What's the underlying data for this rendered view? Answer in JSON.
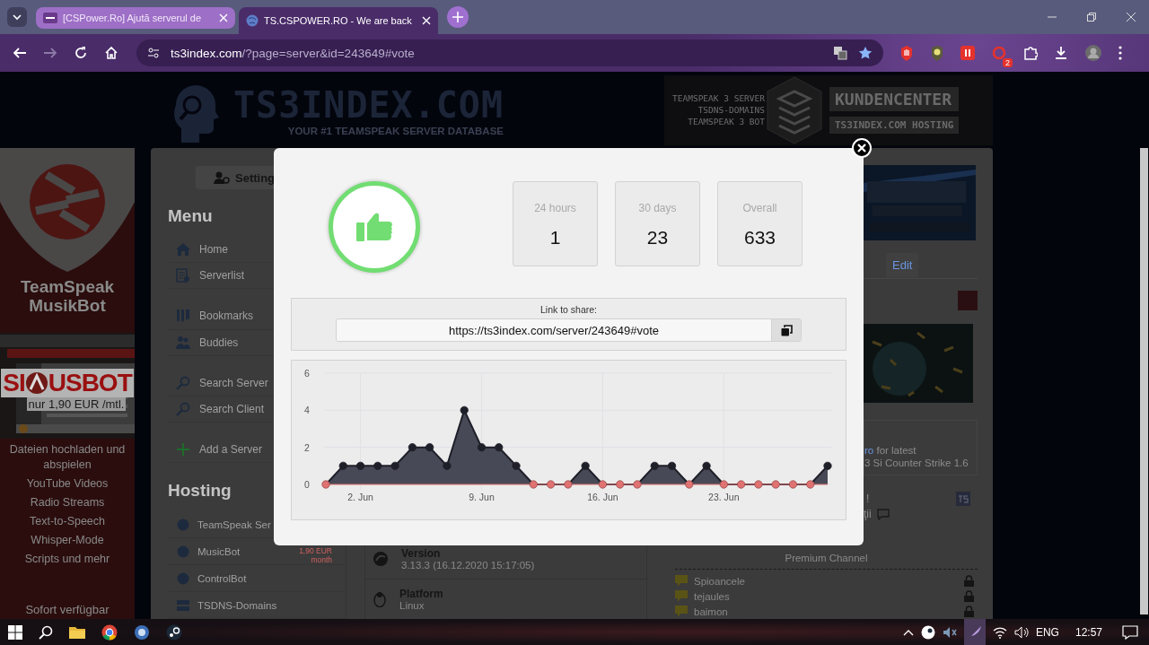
{
  "browser": {
    "tabs": [
      {
        "title": "[CSPower.Ro] Ajută serverul de",
        "selected": false
      },
      {
        "title": "TS.CSPOWER.RO - We are back",
        "selected": true
      }
    ],
    "address": {
      "host": "ts3index.com",
      "path": "/?page=server&id=243649#vote"
    },
    "extension_badge": "2"
  },
  "site_header": {
    "logo": "TS3INDEX.COM",
    "tagline": "YOUR #1 TEAMSPEAK SERVER DATABASE",
    "banner_lines": [
      "TEAMSPEAK 3 SERVER",
      "TSDNS-DOMAINS",
      "TEAMSPEAK 3 BOT"
    ],
    "banner_links": [
      "KUNDENCENTER",
      "TS3INDEX.COM HOSTING"
    ]
  },
  "left_ad": {
    "title": "TeamSpeak MusikBot",
    "brand_start": "SI",
    "brand_end": "USBOT",
    "price": "nur 1,90 EUR /mtl.",
    "features": [
      "Dateien hochladen und abspielen",
      "YouTube Videos",
      "Radio Streams",
      "Text-to-Speech",
      "Whisper-Mode",
      "Scripts und mehr"
    ],
    "footer": "Sofort verfügbar"
  },
  "settings_button": "Setting",
  "menu": {
    "heading": "Menu",
    "groups": [
      [
        "Home",
        "Serverlist"
      ],
      [
        "Bookmarks",
        "Buddies"
      ],
      [
        "Search Server",
        "Search Client"
      ],
      [
        "Add a Server"
      ]
    ]
  },
  "hosting": {
    "heading": "Hosting",
    "items": [
      {
        "label": "TeamSpeak Ser"
      },
      {
        "label": "MusicBot",
        "price": "1,90 EUR",
        "period": "month"
      },
      {
        "label": "ControlBot"
      },
      {
        "label": "TSDNS-Domains"
      }
    ]
  },
  "server_info": [
    {
      "label": "Version",
      "value": "3.13.3 (16.12.2020 15:17:05)"
    },
    {
      "label": "Platform",
      "value": "Linux"
    }
  ],
  "right_panel": {
    "tab": "Edit",
    "link": "ro",
    "text": "for latest",
    "line2": "3 Si Counter Strike 1.6",
    "note1": "!",
    "note2": "ţii"
  },
  "channels": {
    "title": "Premium Channel",
    "items": [
      {
        "name": "Spioancele",
        "locked": true
      },
      {
        "name": "tejaules",
        "locked": true
      },
      {
        "name": "baimon",
        "locked": true
      }
    ]
  },
  "vote_modal": {
    "stats": [
      {
        "label": "24 hours",
        "value": "1"
      },
      {
        "label": "30 days",
        "value": "23"
      },
      {
        "label": "Overall",
        "value": "633"
      }
    ],
    "share": {
      "label": "Link to share:",
      "url": "https://ts3index.com/server/243649#vote"
    },
    "chart_data": {
      "type": "area",
      "categories": [
        null,
        null,
        "2. Jun",
        null,
        null,
        null,
        null,
        null,
        null,
        "9. Jun",
        null,
        null,
        null,
        null,
        null,
        null,
        "16. Jun",
        null,
        null,
        null,
        null,
        null,
        null,
        "23. Jun",
        null,
        null,
        null,
        null,
        null,
        null
      ],
      "grid": true,
      "series": [
        {
          "color": "#474a56",
          "values": [
            0,
            1,
            1,
            1,
            1,
            2,
            2,
            1,
            4,
            2,
            2,
            1,
            0,
            0,
            0,
            1,
            0,
            0,
            0,
            1,
            1,
            0,
            1,
            0,
            0,
            0,
            0,
            0,
            0,
            1
          ]
        }
      ],
      "ylim": [
        0,
        6
      ],
      "yticks": [
        0,
        2,
        4,
        6
      ]
    }
  },
  "taskbar": {
    "language": "ENG",
    "time": "12:57"
  }
}
